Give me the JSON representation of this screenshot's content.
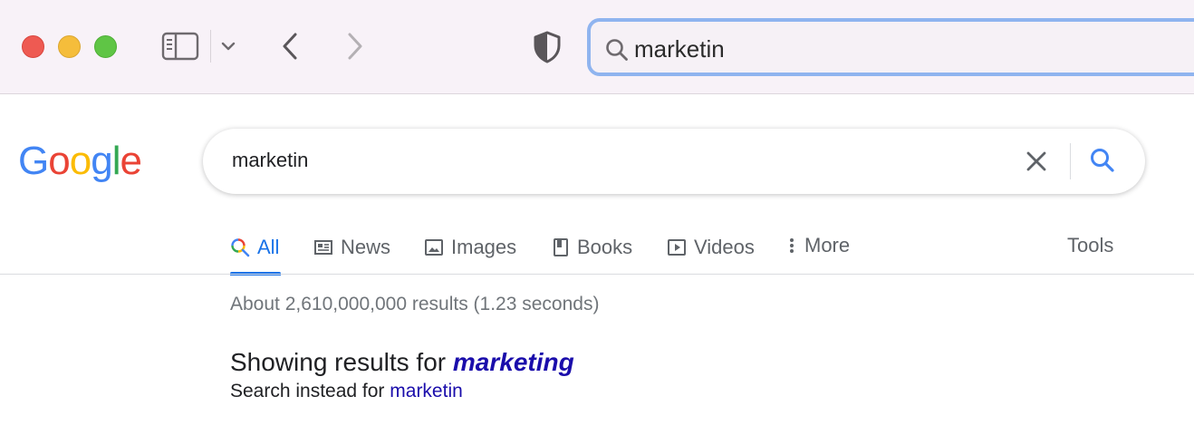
{
  "browser": {
    "address_text": "marketin",
    "colors": {
      "chrome_bg": "#f8f2f8",
      "address_focus": "#8fb4ef"
    },
    "icons": [
      "traffic-light-close",
      "traffic-light-minimize",
      "traffic-light-zoom",
      "sidebar-icon",
      "chevron-down-icon",
      "back-arrow-icon",
      "forward-arrow-icon",
      "privacy-shield-icon",
      "search-icon"
    ]
  },
  "google": {
    "logo": {
      "letters": [
        "G",
        "o",
        "o",
        "g",
        "l",
        "e"
      ],
      "colors": [
        "#4285f4",
        "#ea4335",
        "#fbbc05",
        "#4285f4",
        "#34a853",
        "#ea4335"
      ]
    },
    "search_query": "marketin",
    "tabs": [
      {
        "label": "All",
        "icon": "colored-search-icon",
        "active": true
      },
      {
        "label": "News",
        "icon": "news-icon"
      },
      {
        "label": "Images",
        "icon": "image-icon"
      },
      {
        "label": "Books",
        "icon": "book-icon"
      },
      {
        "label": "Videos",
        "icon": "play-icon"
      },
      {
        "label": "More",
        "icon": "vertical-dots-icon"
      }
    ],
    "tools_label": "Tools",
    "result_stats": "About 2,610,000,000 results (1.23 seconds)",
    "spelling": {
      "prefix": "Showing results for ",
      "corrected": "marketing",
      "instead_prefix": "Search instead for ",
      "original": "marketin"
    },
    "colors": {
      "accent": "#1a73e8",
      "link": "#1a0dab"
    }
  }
}
